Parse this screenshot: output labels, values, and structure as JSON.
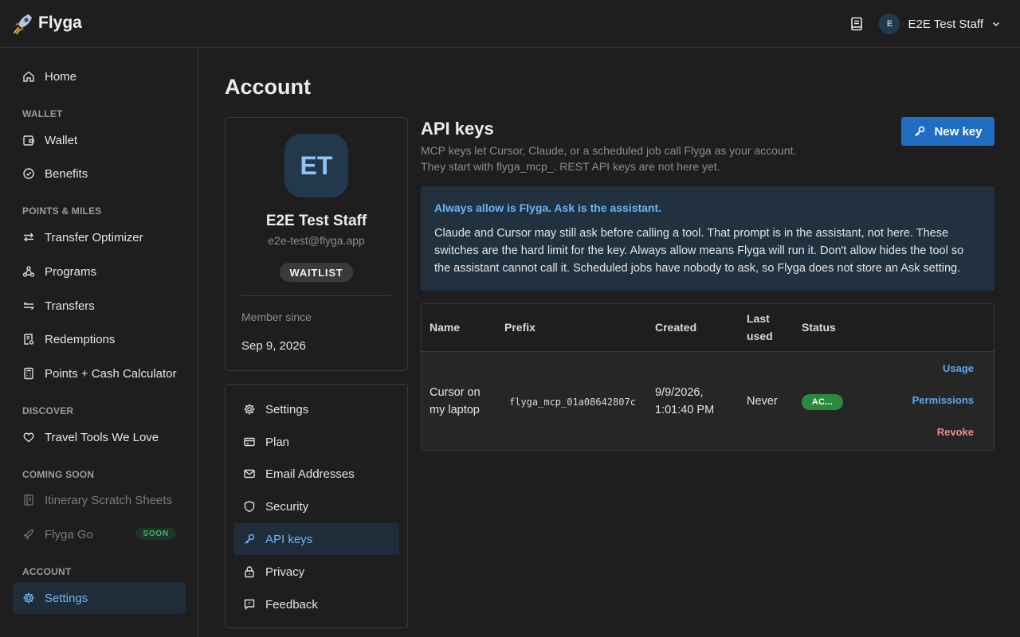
{
  "app": {
    "name": "Flyga"
  },
  "header": {
    "user_initial": "E",
    "user_name": "E2E Test Staff"
  },
  "sidebar": {
    "home": "Home",
    "sections": {
      "wallet": "WALLET",
      "points_miles": "POINTS & MILES",
      "discover": "DISCOVER",
      "coming_soon": "COMING SOON",
      "account": "ACCOUNT"
    },
    "items": {
      "wallet": "Wallet",
      "benefits": "Benefits",
      "transfer_optimizer": "Transfer Optimizer",
      "programs": "Programs",
      "transfers": "Transfers",
      "redemptions": "Redemptions",
      "points_cash": "Points + Cash Calculator",
      "travel_tools": "Travel Tools We Love",
      "itinerary": "Itinerary Scratch Sheets",
      "flyga_go": "Flyga Go",
      "flyga_go_badge": "SOON",
      "settings": "Settings"
    }
  },
  "page": {
    "title": "Account"
  },
  "profile": {
    "initials": "ET",
    "name": "E2E Test Staff",
    "email": "e2e-test@flyga.app",
    "badge": "WAITLIST",
    "member_since_label": "Member since",
    "member_since": "Sep 9, 2026"
  },
  "settings_nav": {
    "settings": "Settings",
    "plan": "Plan",
    "email": "Email Addresses",
    "security": "Security",
    "api_keys": "API keys",
    "privacy": "Privacy",
    "feedback": "Feedback"
  },
  "api": {
    "title": "API keys",
    "desc_line1": "MCP keys let Cursor, Claude, or a scheduled job call Flyga as your account.",
    "desc_line2": "They start with flyga_mcp_. REST API keys are not here yet.",
    "new_key": "New key",
    "info_title": "Always allow is Flyga. Ask is the assistant.",
    "info_body": "Claude and Cursor may still ask before calling a tool. That prompt is in the assistant, not here. These switches are the hard limit for the key. Always allow means Flyga will run it. Don't allow hides the tool so the assistant cannot call it. Scheduled jobs have nobody to ask, so Flyga does not store an Ask setting.",
    "table": {
      "headers": {
        "name": "Name",
        "prefix": "Prefix",
        "created": "Created",
        "last_used_1": "Last",
        "last_used_2": "used",
        "status": "Status"
      },
      "row": {
        "name_1": "Cursor on",
        "name_2": "my laptop",
        "prefix": "flyga_mcp_01a08642807c",
        "created_1": "9/9/2026,",
        "created_2": "1:01:40 PM",
        "last_used": "Never",
        "status": "AC...",
        "usage": "Usage",
        "permissions": "Permissions",
        "revoke": "Revoke"
      }
    }
  }
}
